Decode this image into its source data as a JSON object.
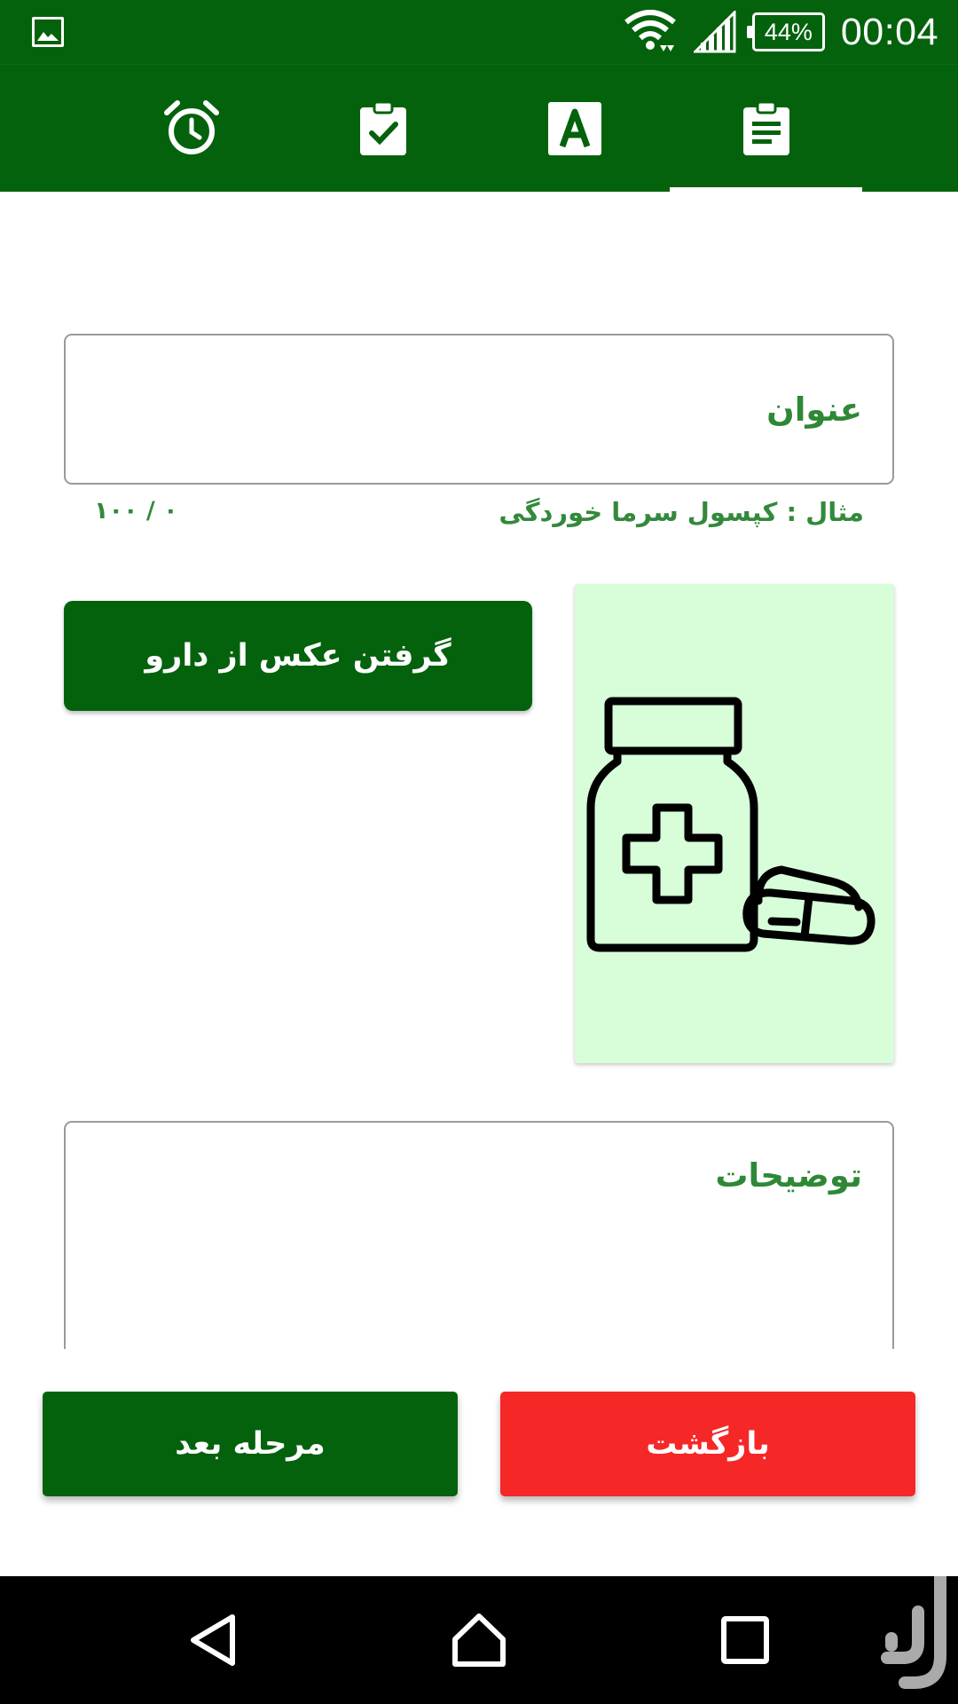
{
  "status_bar": {
    "time": "00:04",
    "battery": "44%",
    "icons": [
      "image-notification-icon",
      "wifi-icon",
      "signal-icon",
      "battery-icon"
    ]
  },
  "tabs": [
    {
      "icon": "alarm-clock-icon",
      "selected": false
    },
    {
      "icon": "clipboard-check-icon",
      "selected": false
    },
    {
      "icon": "letter-a-icon",
      "selected": false
    },
    {
      "icon": "clipboard-list-icon",
      "selected": true
    }
  ],
  "form": {
    "title_placeholder": "عنوان",
    "hint": "مثال : کپسول سرما خوردگی",
    "counter": "۰ / ۱۰۰",
    "photo_button": "گرفتن عکس از دارو",
    "image_icon": "medicine-bottle-pills-icon",
    "description_placeholder": "توضیحات"
  },
  "footer": {
    "next_label": "مرحله بعد",
    "back_label": "بازگشت"
  },
  "nav": [
    "back-icon",
    "home-icon",
    "recents-icon"
  ],
  "colors": {
    "primary": "#04620d",
    "danger": "#f62727",
    "accent_text": "#33893b",
    "image_bg": "#d8fdd9"
  }
}
